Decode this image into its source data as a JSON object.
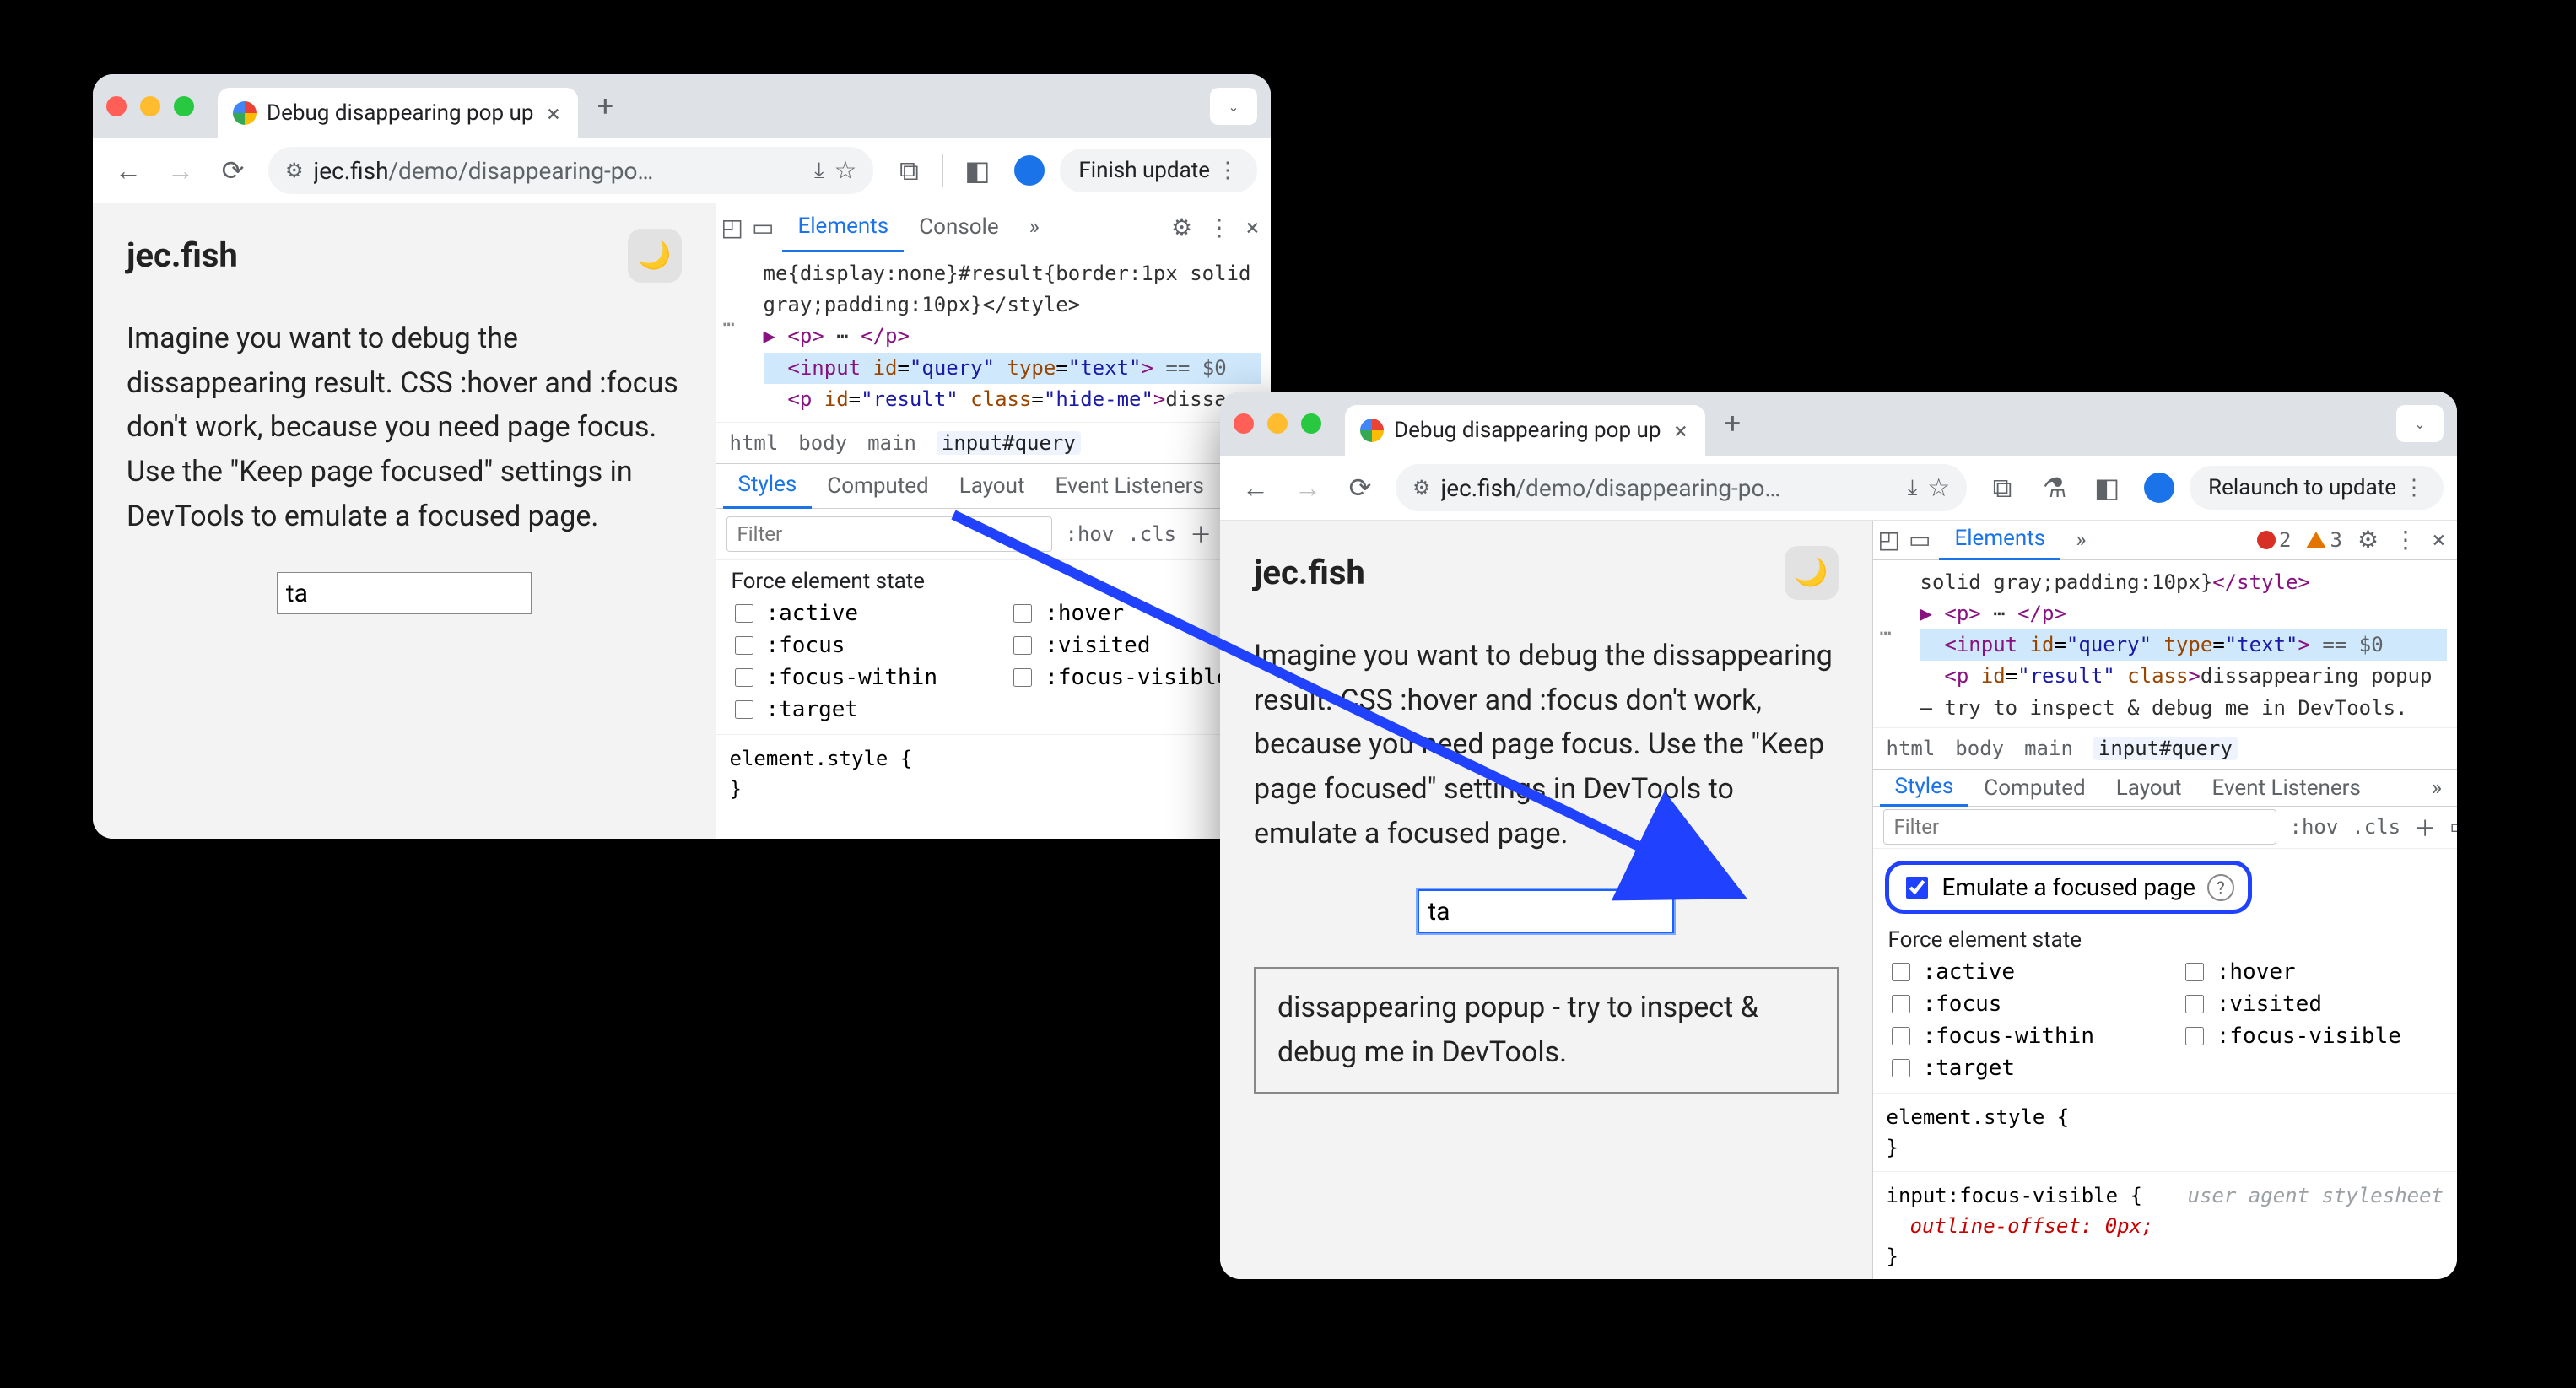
{
  "shared": {
    "tab_title": "Debug disappearing pop up",
    "url_host": "jec.fish",
    "url_path": "/demo/disappearing-po…",
    "brand": "jec.fish",
    "page_paragraph": "Imagine you want to debug the dissappearing result. CSS :hover and :focus don't work, because you need page focus. Use the \"Keep page focused\" settings in DevTools to emulate a focused page.",
    "input_value": "ta",
    "dt": {
      "tabs": [
        "Elements",
        "Console"
      ],
      "styles_tabs": [
        "Styles",
        "Computed",
        "Layout",
        "Event Listeners"
      ],
      "filter_ph": "Filter",
      "hov": ":hov",
      "cls": ".cls",
      "force_hdr": "Force element state",
      "forces_left": [
        ":active",
        ":focus",
        ":focus-within",
        ":target"
      ],
      "forces_right": [
        ":hover",
        ":visited",
        ":focus-visible"
      ],
      "crumbs": [
        "html",
        "body",
        "main",
        "input#query"
      ],
      "el_style": "element.style {",
      "brace_close": "}"
    }
  },
  "win1": {
    "finish_btn": "Finish update",
    "dom_line1": "me{display:none}#result{border:1px solid gray;padding:10px}</style>",
    "dom_line_p": "▶ <p>…</p>",
    "dom_sel": "<input id=\"query\" type=\"text\"> == $0",
    "dom_line_res": "<p id=\"result\" class=\"hide-me\">dissap…"
  },
  "win2": {
    "relaunch_btn": "Relaunch to update",
    "err_count": "2",
    "warn_count": "3",
    "dom_line1_a": "solid gray;padding:10px}",
    "dom_line1_b": "</style>",
    "dom_line_p": "▶ <p>…</p>",
    "dom_sel": "<input id=\"query\" type=\"text\"> == $0",
    "dom_line_res": "<p id=\"result\" class>dissappearing popup - try to inspect & debug me in DevTools.</p>",
    "emu_label": "Emulate a focused page",
    "popup_text": "dissappearing popup - try to inspect & debug me in DevTools.",
    "rule2_sel": "input:focus-visible {",
    "rule2_comment": "user agent stylesheet",
    "rule2_decl": "outline-offset: 0px;"
  }
}
